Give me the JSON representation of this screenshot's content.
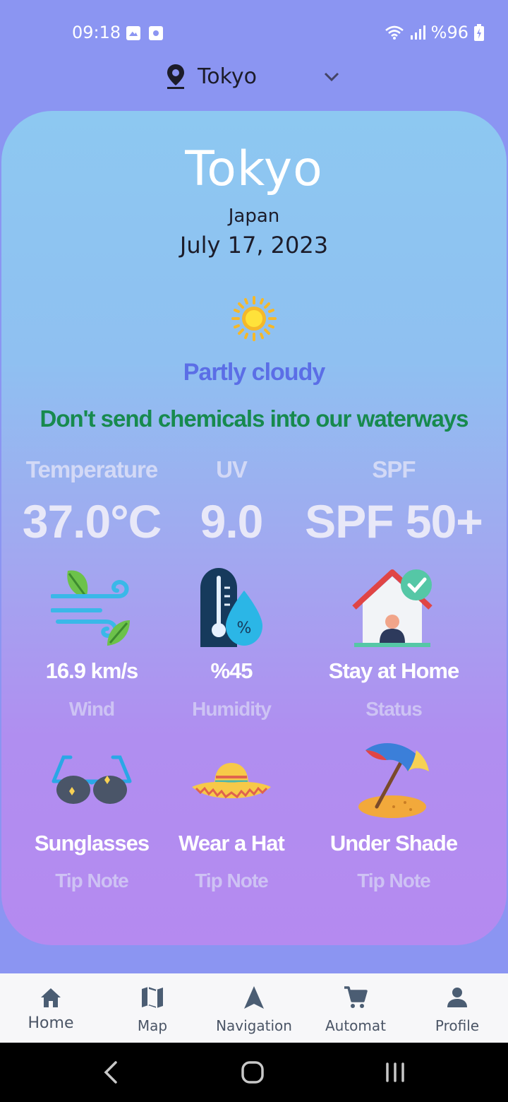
{
  "status_bar": {
    "time": "09:18",
    "battery": "%96",
    "icons": [
      "gallery-icon",
      "camera-icon",
      "wifi-icon",
      "signal-icon",
      "battery-charging-icon"
    ]
  },
  "location_selector": {
    "value": "Tokyo",
    "icons": [
      "location-pin-icon",
      "chevron-down-icon"
    ]
  },
  "weather": {
    "city": "Tokyo",
    "country": "Japan",
    "date": "July 17, 2023",
    "condition": "Partly cloudy",
    "condition_icon": "sun-icon",
    "message": "Don't send chemicals into our waterways"
  },
  "stats": {
    "temperature": {
      "label": "Temperature",
      "value": "37.0°C"
    },
    "uv": {
      "label": "UV",
      "value": "9.0"
    },
    "spf": {
      "label": "SPF",
      "value": "SPF 50+"
    }
  },
  "details": [
    {
      "icon": "wind-icon",
      "value": "16.9 km/s",
      "caption": "Wind"
    },
    {
      "icon": "humidity-icon",
      "value": "%45",
      "caption": "Humidity"
    },
    {
      "icon": "house-check-icon",
      "value": "Stay at Home",
      "caption": "Status"
    }
  ],
  "tips": [
    {
      "icon": "sunglasses-icon",
      "value": "Sunglasses",
      "caption": "Tip Note"
    },
    {
      "icon": "hat-icon",
      "value": "Wear a Hat",
      "caption": "Tip Note"
    },
    {
      "icon": "beach-umbrella-icon",
      "value": "Under Shade",
      "caption": "Tip Note"
    }
  ],
  "bottom_nav": [
    {
      "label": "Home",
      "icon": "home-icon",
      "active": true
    },
    {
      "label": "Map",
      "icon": "map-icon",
      "active": false
    },
    {
      "label": "Navigation",
      "icon": "navigation-icon",
      "active": false
    },
    {
      "label": "Automat",
      "icon": "cart-icon",
      "active": false
    },
    {
      "label": "Profile",
      "icon": "profile-icon",
      "active": false
    }
  ],
  "colors": {
    "background": "#8b95f2",
    "condition": "#5b6ee6",
    "message": "#178a4e",
    "nav_bar": "#f7f7f9"
  }
}
